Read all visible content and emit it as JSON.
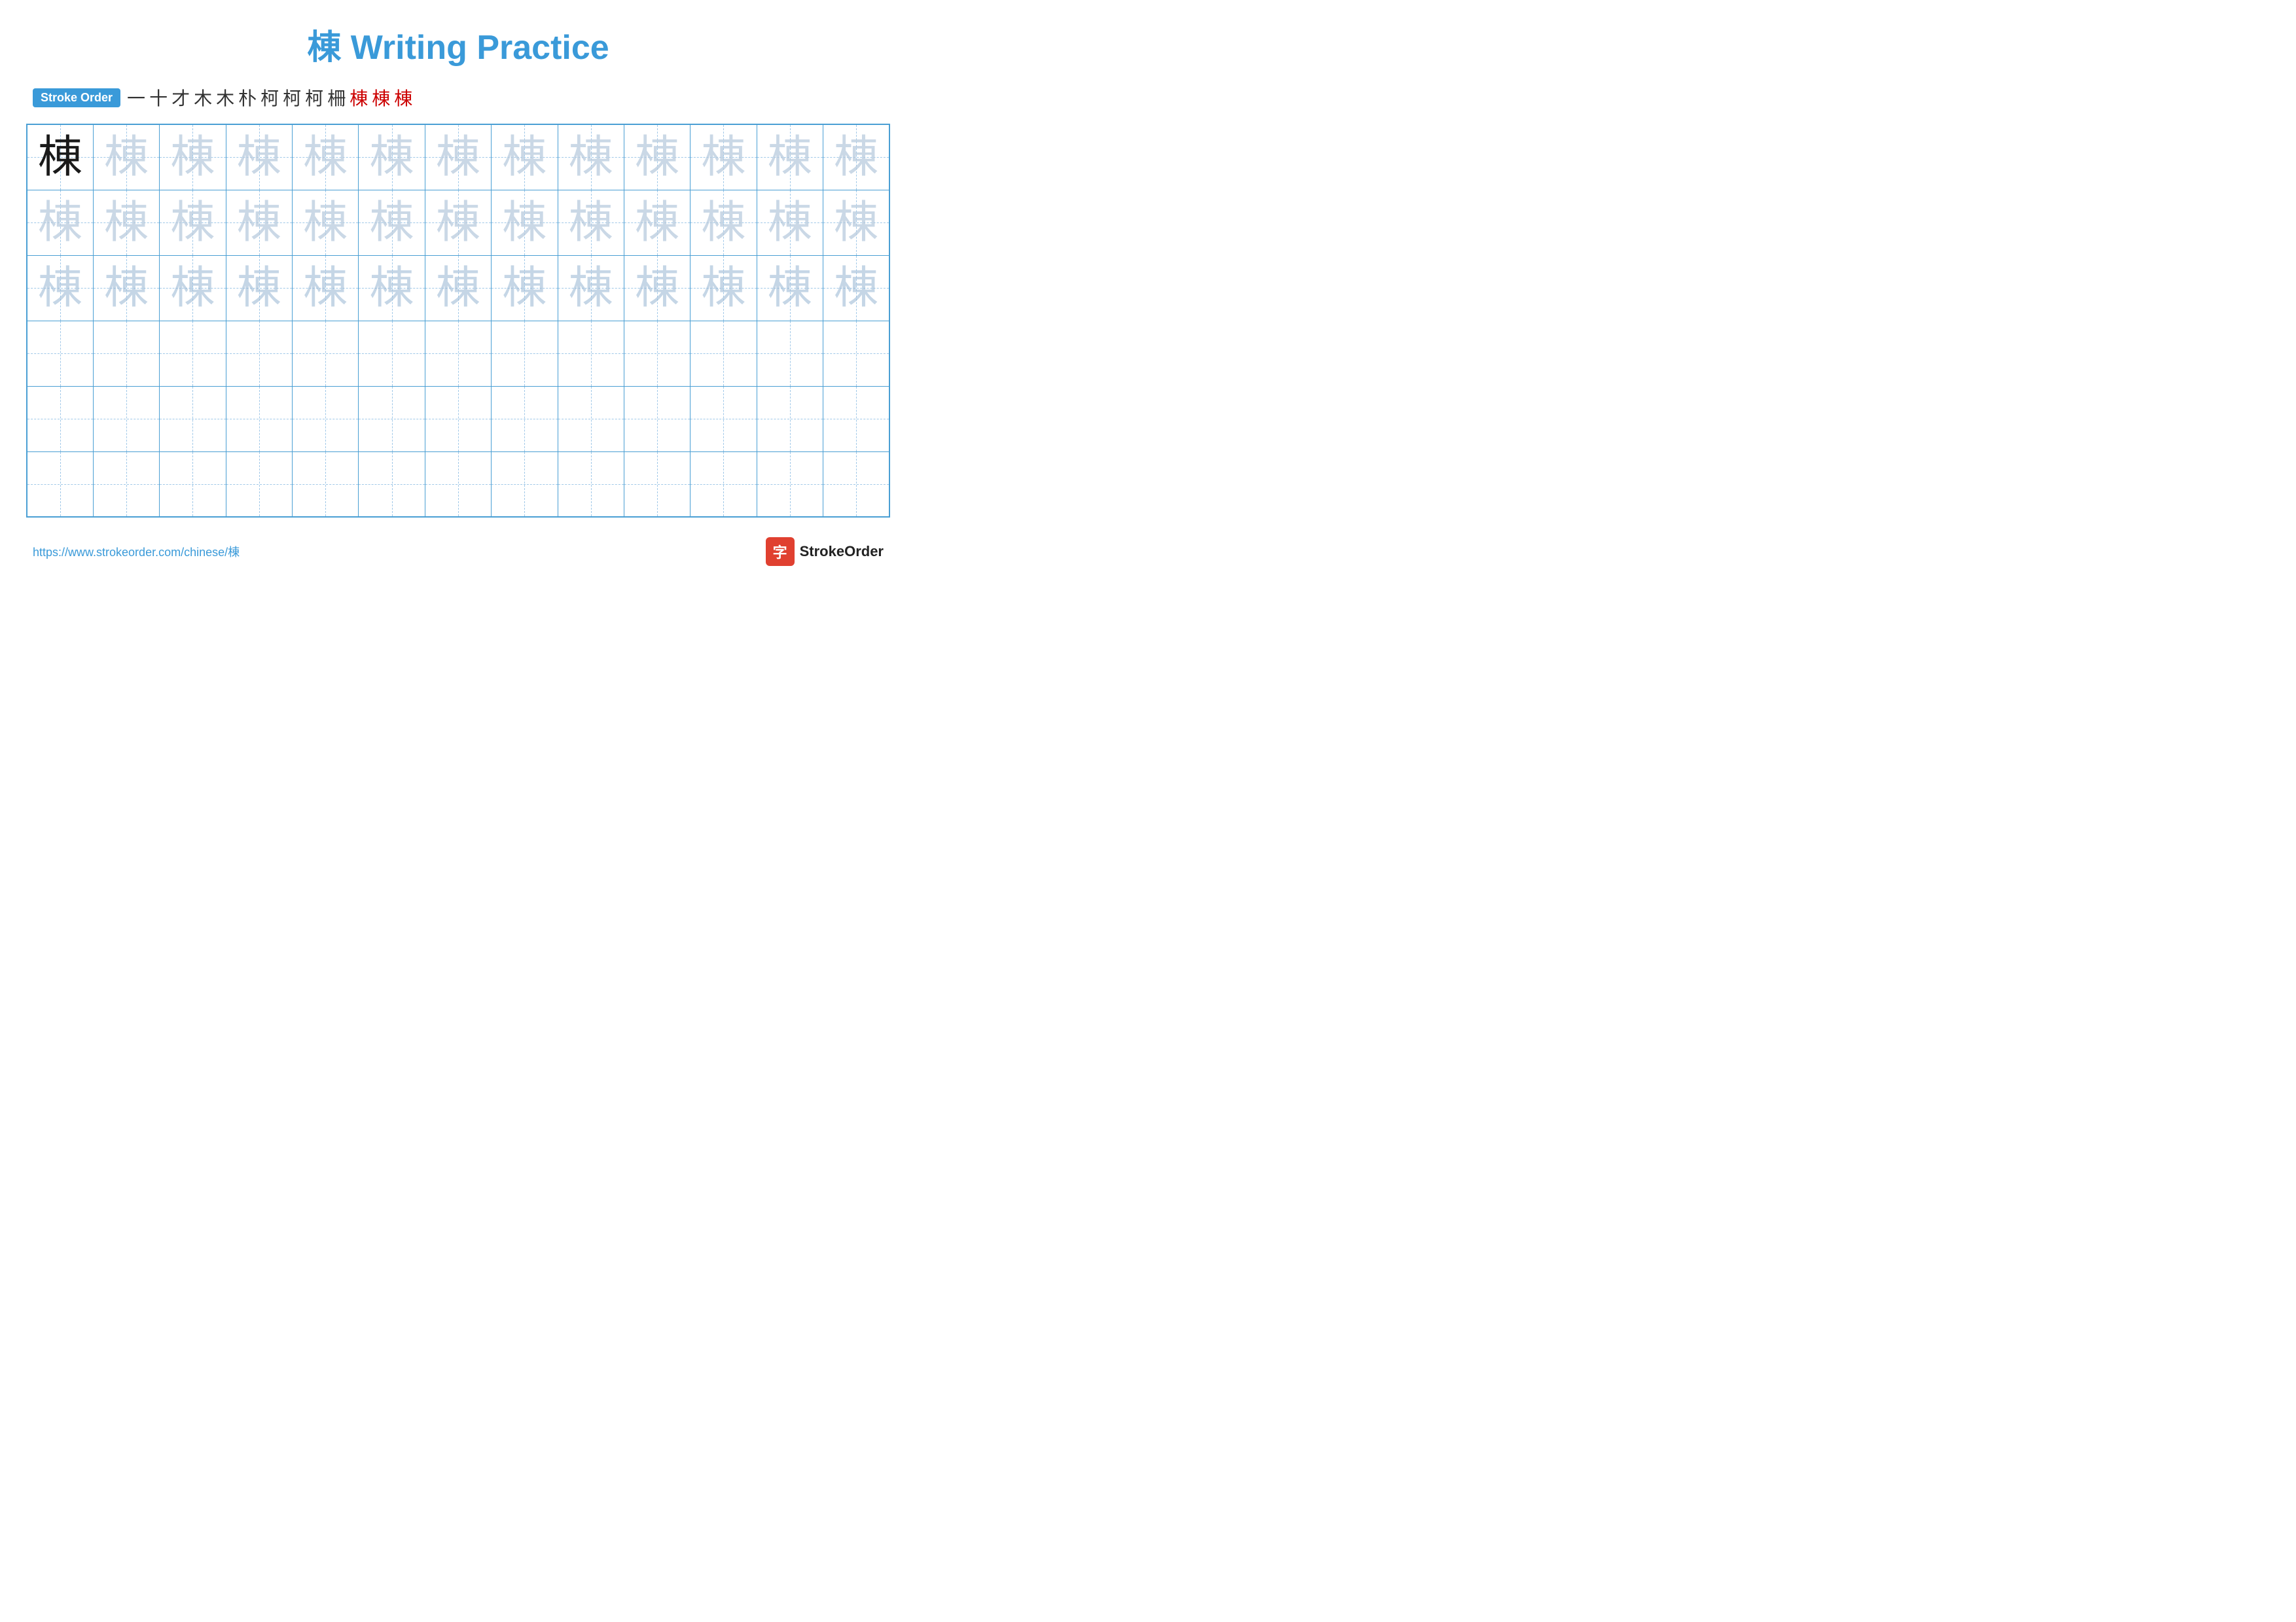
{
  "title": {
    "text": "棟 Writing Practice"
  },
  "stroke_order": {
    "badge_label": "Stroke Order",
    "strokes": [
      "一",
      "十",
      "才",
      "木",
      "木",
      "朴",
      "柯",
      "柯",
      "柯",
      "柵",
      "棟",
      "棟",
      "棟"
    ]
  },
  "grid": {
    "rows": 6,
    "cols": 13,
    "character": "棟",
    "row_types": [
      "dark_then_light",
      "light",
      "medium",
      "empty",
      "empty",
      "empty"
    ]
  },
  "footer": {
    "url": "https://www.strokeorder.com/chinese/棟",
    "brand_icon": "字",
    "brand_name": "StrokeOrder"
  }
}
